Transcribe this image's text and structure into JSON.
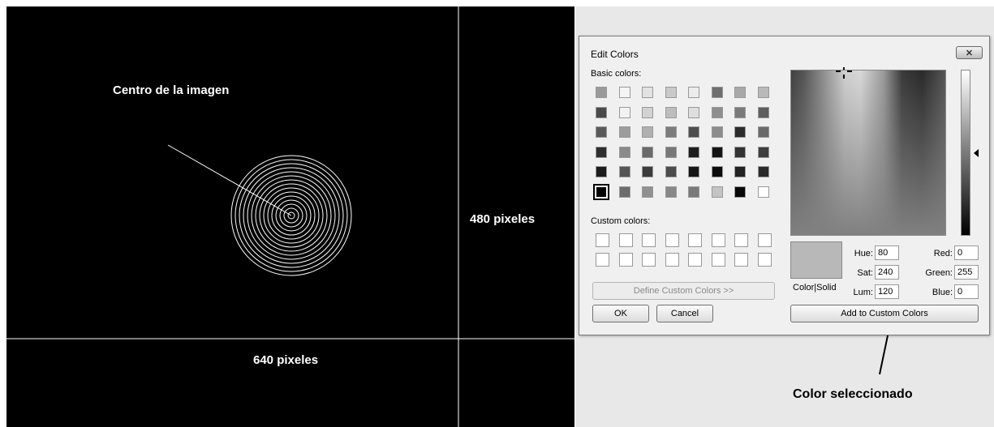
{
  "canvas": {
    "center_label": "Centro de la imagen",
    "height_label": "480 pixeles",
    "width_label": "640 pixeles"
  },
  "annotation": {
    "selected_color_label": "Color seleccionado"
  },
  "dialog": {
    "title": "Edit Colors",
    "close_icon": "close-icon",
    "basic_colors_label": "Basic colors:",
    "custom_colors_label": "Custom colors:",
    "define_custom_button": "Define Custom Colors >>",
    "ok_button": "OK",
    "cancel_button": "Cancel",
    "color_solid_label": "Color|Solid",
    "add_custom_button": "Add to Custom Colors",
    "fields": {
      "hue": {
        "label": "Hue:",
        "value": "80"
      },
      "sat": {
        "label": "Sat:",
        "value": "240"
      },
      "lum": {
        "label": "Lum:",
        "value": "120"
      },
      "red": {
        "label": "Red:",
        "value": "0"
      },
      "green": {
        "label": "Green:",
        "value": "255"
      },
      "blue": {
        "label": "Blue:",
        "value": "0"
      }
    },
    "basic_colors": [
      [
        "#9a9a9a",
        "#f4f4f4",
        "#e2e2e2",
        "#c9c9c9",
        "#ececec",
        "#6e6e6e",
        "#a8a8a8",
        "#b9b9b9"
      ],
      [
        "#4a4a4a",
        "#f2f2f2",
        "#d2d2d2",
        "#bdbdbd",
        "#dedede",
        "#8e8e8e",
        "#7a7a7a",
        "#5e5e5e"
      ],
      [
        "#5a5a5a",
        "#9c9c9c",
        "#b0b0b0",
        "#7c7c7c",
        "#4e4e4e",
        "#8c8c8c",
        "#2c2c2c",
        "#6a6a6a"
      ],
      [
        "#2e2e2e",
        "#8a8a8a",
        "#6a6a6a",
        "#787878",
        "#1e1e1e",
        "#141414",
        "#333333",
        "#3e3e3e"
      ],
      [
        "#1c1c1c",
        "#555555",
        "#3c3c3c",
        "#4c4c4c",
        "#161616",
        "#0c0c0c",
        "#222222",
        "#2a2a2a"
      ],
      [
        "#000000",
        "#6c6c6c",
        "#909090",
        "#888888",
        "#7a7a7a",
        "#c4c4c4",
        "#080808",
        "#ffffff"
      ]
    ],
    "selected_basic_index": "0"
  }
}
